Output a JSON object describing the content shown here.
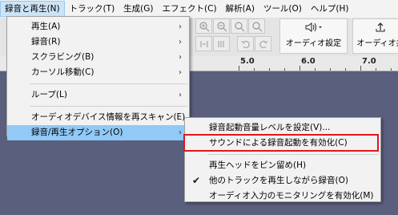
{
  "menubar": {
    "items": [
      {
        "label": "録音と再生(N)",
        "active": true
      },
      {
        "label": "トラック(T)"
      },
      {
        "label": "生成(G)"
      },
      {
        "label": "エフェクト(C)"
      },
      {
        "label": "解析(A)"
      },
      {
        "label": "ツール(O)"
      },
      {
        "label": "ヘルプ(H)"
      }
    ]
  },
  "toolbar": {
    "audio_setup_label": "オーディオ設定",
    "share_audio_label": "オーディオ共",
    "speaker_icon": "speaker-icon",
    "share_icon": "share-icon"
  },
  "ruler": {
    "labels": [
      "5.0",
      "6.0",
      "7.0"
    ]
  },
  "main_menu": {
    "items": [
      {
        "label": "再生(A)",
        "submenu": true
      },
      {
        "label": "録音(R)",
        "submenu": true
      },
      {
        "label": "スクラビング(B)",
        "submenu": true
      },
      {
        "label": "カーソル移動(C)",
        "submenu": true
      },
      {
        "label": "ループ(L)",
        "submenu": true
      },
      {
        "label": "オーディオデバイス情報を再スキャン(E)",
        "submenu": false
      },
      {
        "label": "録音/再生オプション(O)",
        "submenu": true,
        "highlighted": true
      }
    ]
  },
  "sub_menu": {
    "items": [
      {
        "label": "録音起動音量レベルを設定(V)..."
      },
      {
        "label": "サウンドによる録音起動を有効化(C)",
        "outlined": true
      },
      {
        "label": "再生ヘッドをピン留め(H)"
      },
      {
        "label": "他のトラックを再生しながら録音(O)",
        "checked": true
      },
      {
        "label": "オーディオ入力のモニタリングを有効化(M)"
      }
    ]
  },
  "colors": {
    "track_bg": "#5a5f7d",
    "highlight": "#91c9f7",
    "outline": "#e0161f"
  }
}
